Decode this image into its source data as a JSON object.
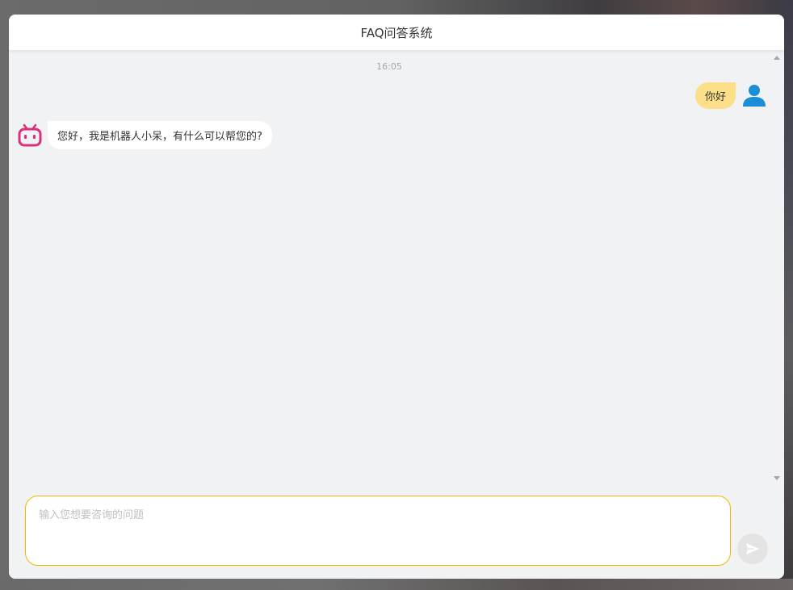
{
  "header": {
    "title": "FAQ问答系统"
  },
  "messages": [
    {
      "timestamp": "16:05",
      "sender": "user",
      "text": "你好",
      "avatar_icon": "user-icon"
    },
    {
      "sender": "bot",
      "text": "您好，我是机器人小呆，有什么可以帮您的?",
      "avatar_icon": "robot-icon"
    }
  ],
  "input": {
    "placeholder": "输入您想要咨询的问题",
    "value": ""
  },
  "send_button": {
    "icon": "send-icon"
  },
  "colors": {
    "user_bubble": "#fddf8a",
    "bot_bubble": "#ffffff",
    "user_avatar": "#1a8fd6",
    "bot_avatar": "#d9317a",
    "input_border": "#f2b600",
    "background": "#f1f2f4"
  }
}
